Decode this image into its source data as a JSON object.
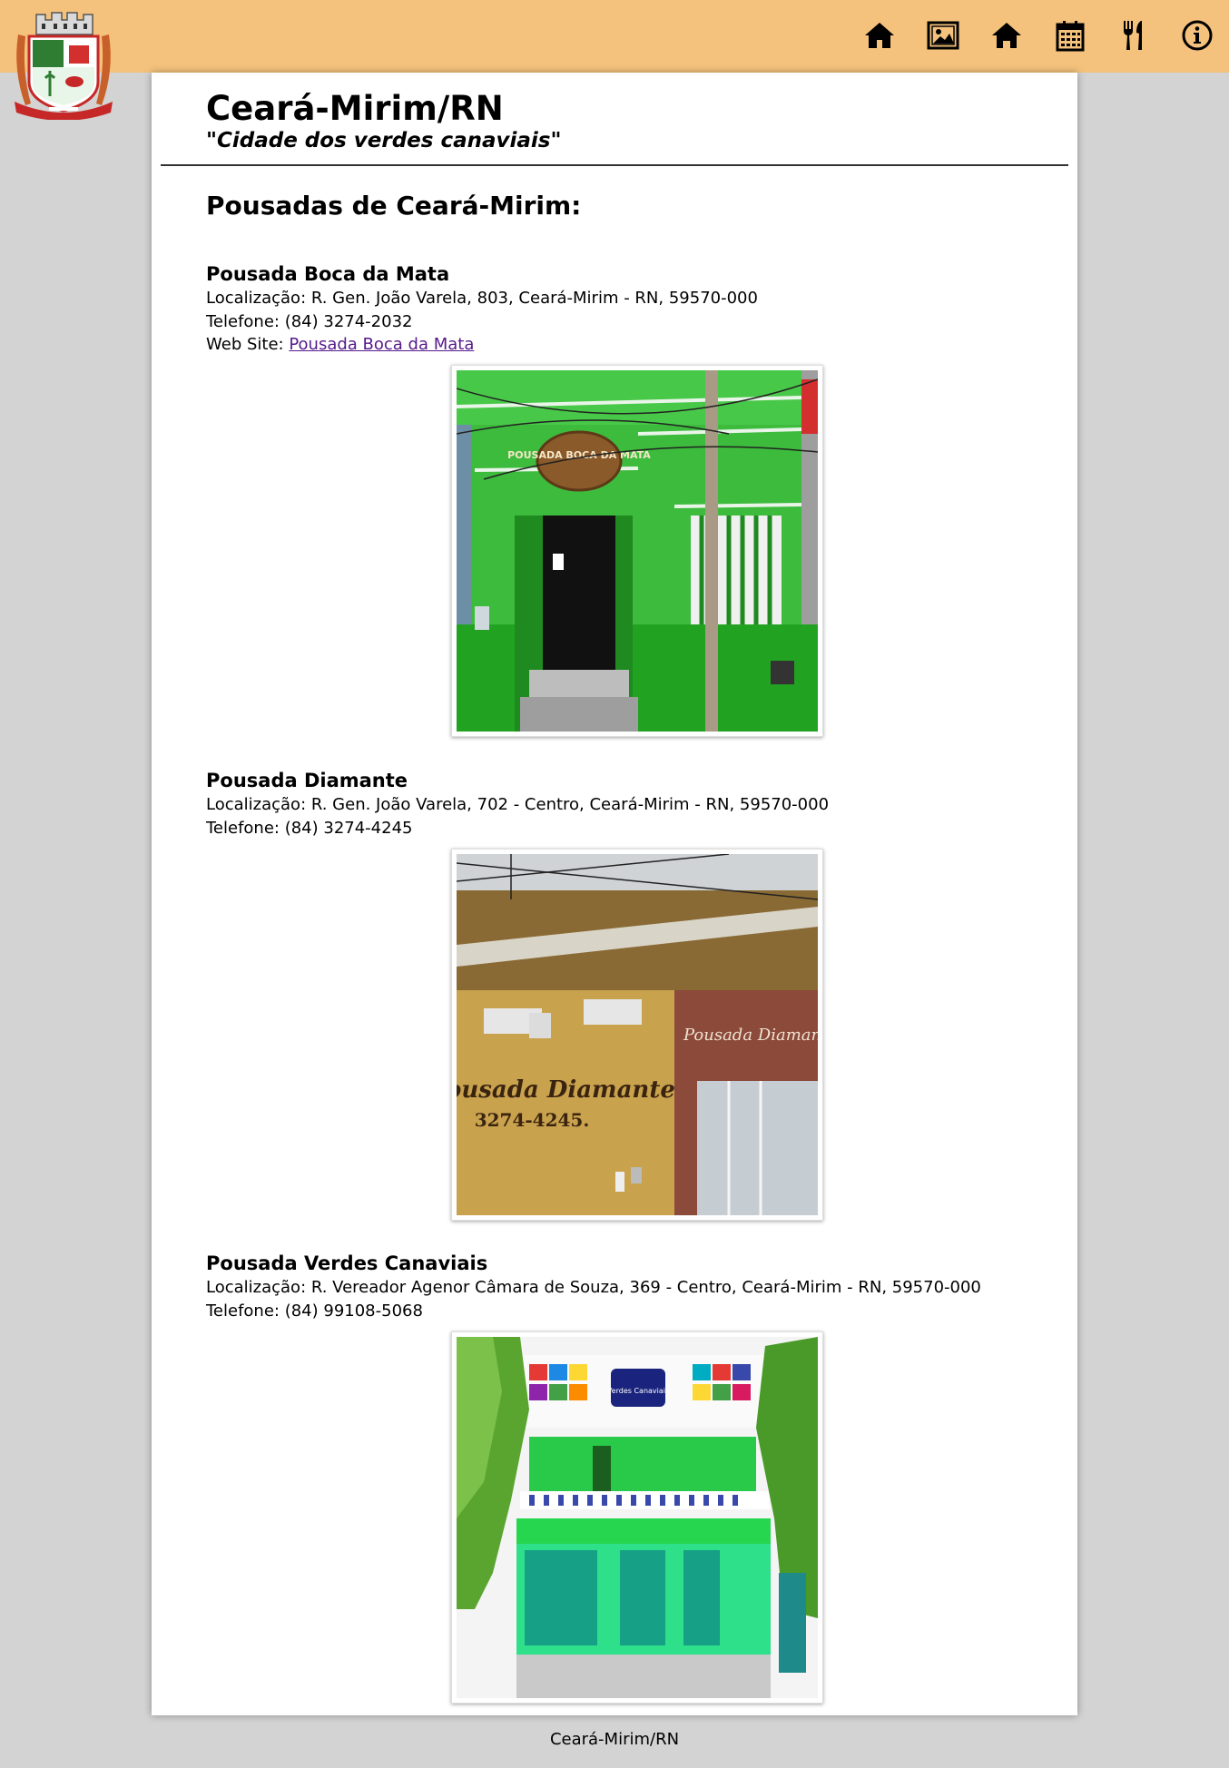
{
  "header": {
    "nav": [
      {
        "name": "home-icon"
      },
      {
        "name": "gallery-icon"
      },
      {
        "name": "lodging-icon"
      },
      {
        "name": "calendar-icon"
      },
      {
        "name": "restaurant-icon"
      },
      {
        "name": "info-icon"
      }
    ],
    "colors": {
      "bar": "#f4c27c",
      "background": "#d3d3d3"
    }
  },
  "main": {
    "title": "Ceará-Mirim/RN",
    "subtitle": "\"Cidade dos verdes canaviais\"",
    "section_title": "Pousadas de Ceará-Mirim:",
    "pousadas": [
      {
        "name": "Pousada Boca da Mata",
        "location": "Localização: R. Gen. João Varela, 803, Ceará-Mirim - RN, 59570-000",
        "phone": "Telefone: (84) 3274-2032",
        "website_label": "Web Site: ",
        "website_link": "Pousada Boca da Mata",
        "sign_text": "POUSADA BOCA DA MATA"
      },
      {
        "name": "Pousada Diamante",
        "location": "Localização: R. Gen. João Varela, 702 - Centro, Ceará-Mirim - RN, 59570-000",
        "phone": "Telefone: (84) 3274-4245",
        "sign_text": "Pousada Diamante",
        "sign_phone": "3274-4245.",
        "side_sign": "Pousada Diamante"
      },
      {
        "name": "Pousada Verdes Canaviais",
        "location": "Localização: R. Vereador Agenor Câmara de Souza, 369 - Centro, Ceará-Mirim - RN, 59570-000",
        "phone": "Telefone: (84) 99108-5068",
        "sign_text": "Verdes Canaviais"
      }
    ]
  },
  "footer": {
    "text": "Ceará-Mirim/RN"
  }
}
